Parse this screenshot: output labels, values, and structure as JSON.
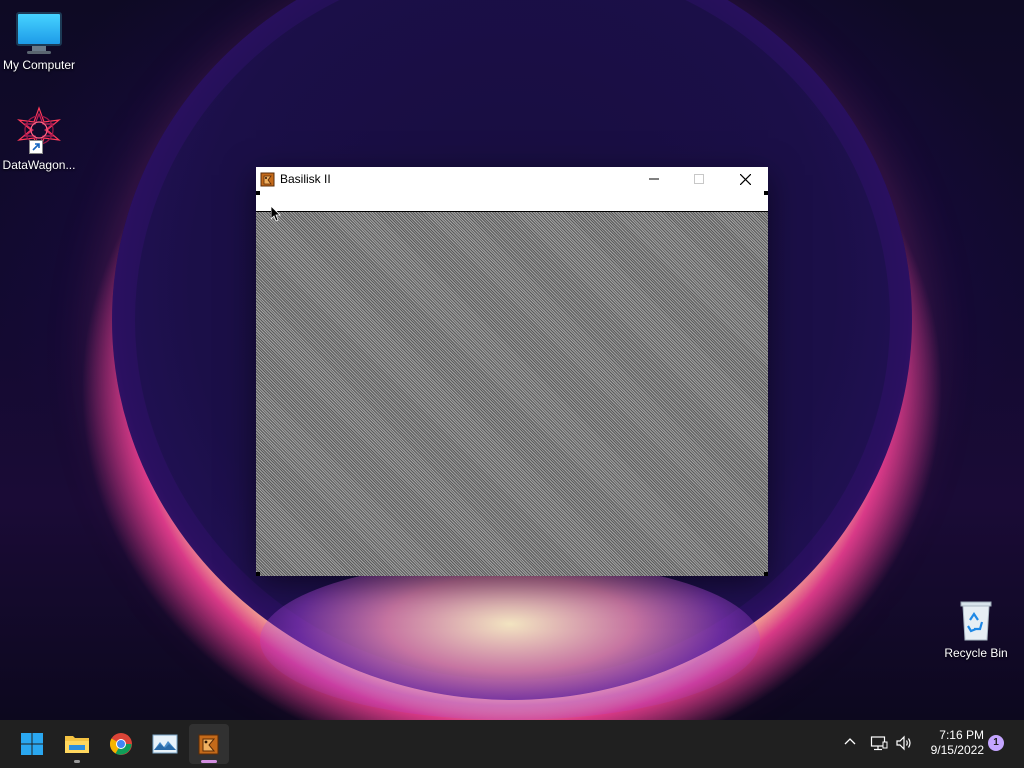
{
  "desktop": {
    "icons": [
      {
        "label": "My Computer",
        "icon": "monitor-icon"
      },
      {
        "label": "DataWagon...",
        "icon": "datawagon-icon"
      },
      {
        "label": "Recycle Bin",
        "icon": "recycle-bin-icon"
      }
    ]
  },
  "window": {
    "title": "Basilisk II",
    "icon": "basilisk-app-icon",
    "controls": {
      "minimize": "minimize-icon",
      "maximize": "maximize-icon",
      "close": "close-icon"
    }
  },
  "taskbar": {
    "apps": [
      {
        "name": "start",
        "icon": "windows-start-icon"
      },
      {
        "name": "file-explorer",
        "icon": "folder-icon"
      },
      {
        "name": "chrome",
        "icon": "chrome-icon"
      },
      {
        "name": "image-viewer",
        "icon": "photo-icon"
      },
      {
        "name": "basilisk",
        "icon": "basilisk-app-icon",
        "active": true
      }
    ],
    "tray": {
      "chevron": "chevron-up-icon",
      "network": "network-icon",
      "volume": "volume-icon"
    },
    "clock": {
      "time": "7:16 PM",
      "date": "9/15/2022"
    },
    "notification_count": "1"
  },
  "colors": {
    "taskbar_bg": "#202020",
    "accent": "#c4a5ff",
    "indicator_active": "#d38fe0"
  }
}
